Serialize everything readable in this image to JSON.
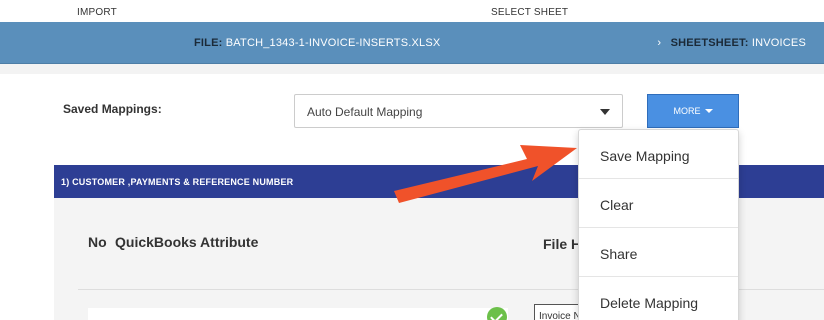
{
  "steps": {
    "import_label": "IMPORT",
    "select_sheet_label": "SELECT SHEET"
  },
  "file_bar": {
    "file_prefix": "FILE:",
    "file_name": "BATCH_1343-1-INVOICE-INSERTS.XLSX",
    "sheet_chevron": "›",
    "sheet_prefix": "SHEETSHEET:",
    "sheet_name": "INVOICES"
  },
  "saved_mappings": {
    "label": "Saved Mappings:",
    "selected_value": "Auto Default Mapping",
    "more_button_label": "MORE"
  },
  "menu": {
    "items": [
      "Save Mapping",
      "Clear",
      "Share",
      "Delete Mapping"
    ]
  },
  "section": {
    "title": "1) CUSTOMER ,PAYMENTS & REFERENCE NUMBER",
    "col_no": "No",
    "col_attribute": "QuickBooks Attribute",
    "col_file": "File H",
    "row_input_value": "Invoice N"
  },
  "colors": {
    "file_bar": "#5a8fbb",
    "section_bar": "#2d3e94",
    "more_button": "#4a90e2",
    "arrow": "#f0522a",
    "check": "#6cc04a"
  }
}
